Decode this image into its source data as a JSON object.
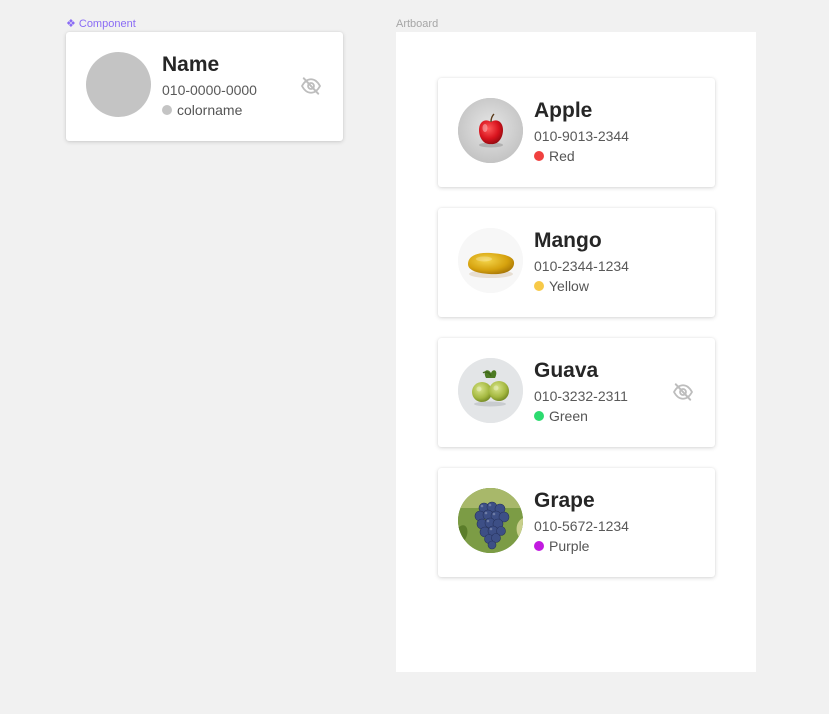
{
  "labels": {
    "component": "Component",
    "artboard": "Artboard"
  },
  "component_card": {
    "name": "Name",
    "phone": "010-0000-0000",
    "color_name": "colorname",
    "dot_color": "#c4c4c4",
    "icon": "eye-off-icon"
  },
  "contacts": [
    {
      "name": "Apple",
      "phone": "010-9013-2344",
      "color_name": "Red",
      "dot_color": "#f0413f",
      "image": "apple"
    },
    {
      "name": "Mango",
      "phone": "010-2344-1234",
      "color_name": "Yellow",
      "dot_color": "#f7c948",
      "image": "mango"
    },
    {
      "name": "Guava",
      "phone": "010-3232-2311",
      "color_name": "Green",
      "dot_color": "#2cdb6f",
      "image": "guava",
      "icon": "eye-off-icon"
    },
    {
      "name": "Grape",
      "phone": "010-5672-1234",
      "color_name": "Purple",
      "dot_color": "#c21ae0",
      "image": "grape"
    }
  ]
}
